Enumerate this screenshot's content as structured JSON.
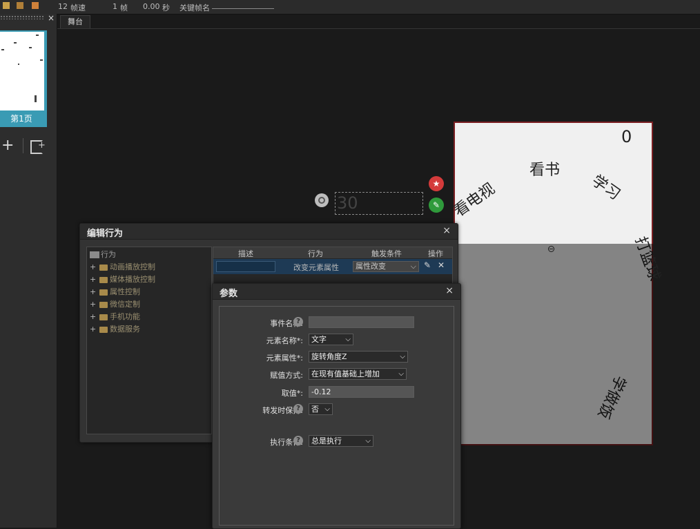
{
  "topbar": {
    "fps_value": "12",
    "fps_label": "帧速",
    "frame_value": "1",
    "frame_label": "帧",
    "time_value": "0.00",
    "time_label": "秒",
    "keyframe_label": "关键帧名"
  },
  "left_panel": {
    "close_label": "×",
    "page_label": "第1页",
    "add_page_label": "+"
  },
  "stage": {
    "tab_label": "舞台",
    "canvas_texts": {
      "counter": "0",
      "read": "看书",
      "study": "学习",
      "tv": "看电视",
      "basketball": "打篮球",
      "cook": "学做饭"
    },
    "timer_value": "30"
  },
  "edit_dialog": {
    "title": "编辑行为",
    "close_label": "×",
    "tree": {
      "root": "行为",
      "items": [
        "动画播放控制",
        "媒体播放控制",
        "属性控制",
        "微信定制",
        "手机功能",
        "数据服务"
      ]
    },
    "grid": {
      "headers": [
        "描述",
        "行为",
        "触发条件",
        "操作"
      ],
      "row": {
        "description": "",
        "action": "改变元素属性",
        "trigger": "属性改变"
      }
    }
  },
  "param_dialog": {
    "title": "参数",
    "close_label": "×",
    "fields": {
      "event_name_label": "事件名称:",
      "event_name_value": "",
      "element_name_label": "元素名称*:",
      "element_name_value": "文字",
      "element_prop_label": "元素属性*:",
      "element_prop_value": "旋转角度Z",
      "assign_label": "赋值方式:",
      "assign_value": "在现有值基础上增加",
      "value_label": "取值*:",
      "value_value": "-0.12",
      "keep_label": "转发时保持:",
      "keep_value": "否",
      "exec_label": "执行条件:",
      "exec_value": "总是执行"
    }
  },
  "colors": {
    "canvas_border": "#7a1f22",
    "thumb_accent": "#3a9bb4",
    "selected_row": "#1e3a55"
  }
}
